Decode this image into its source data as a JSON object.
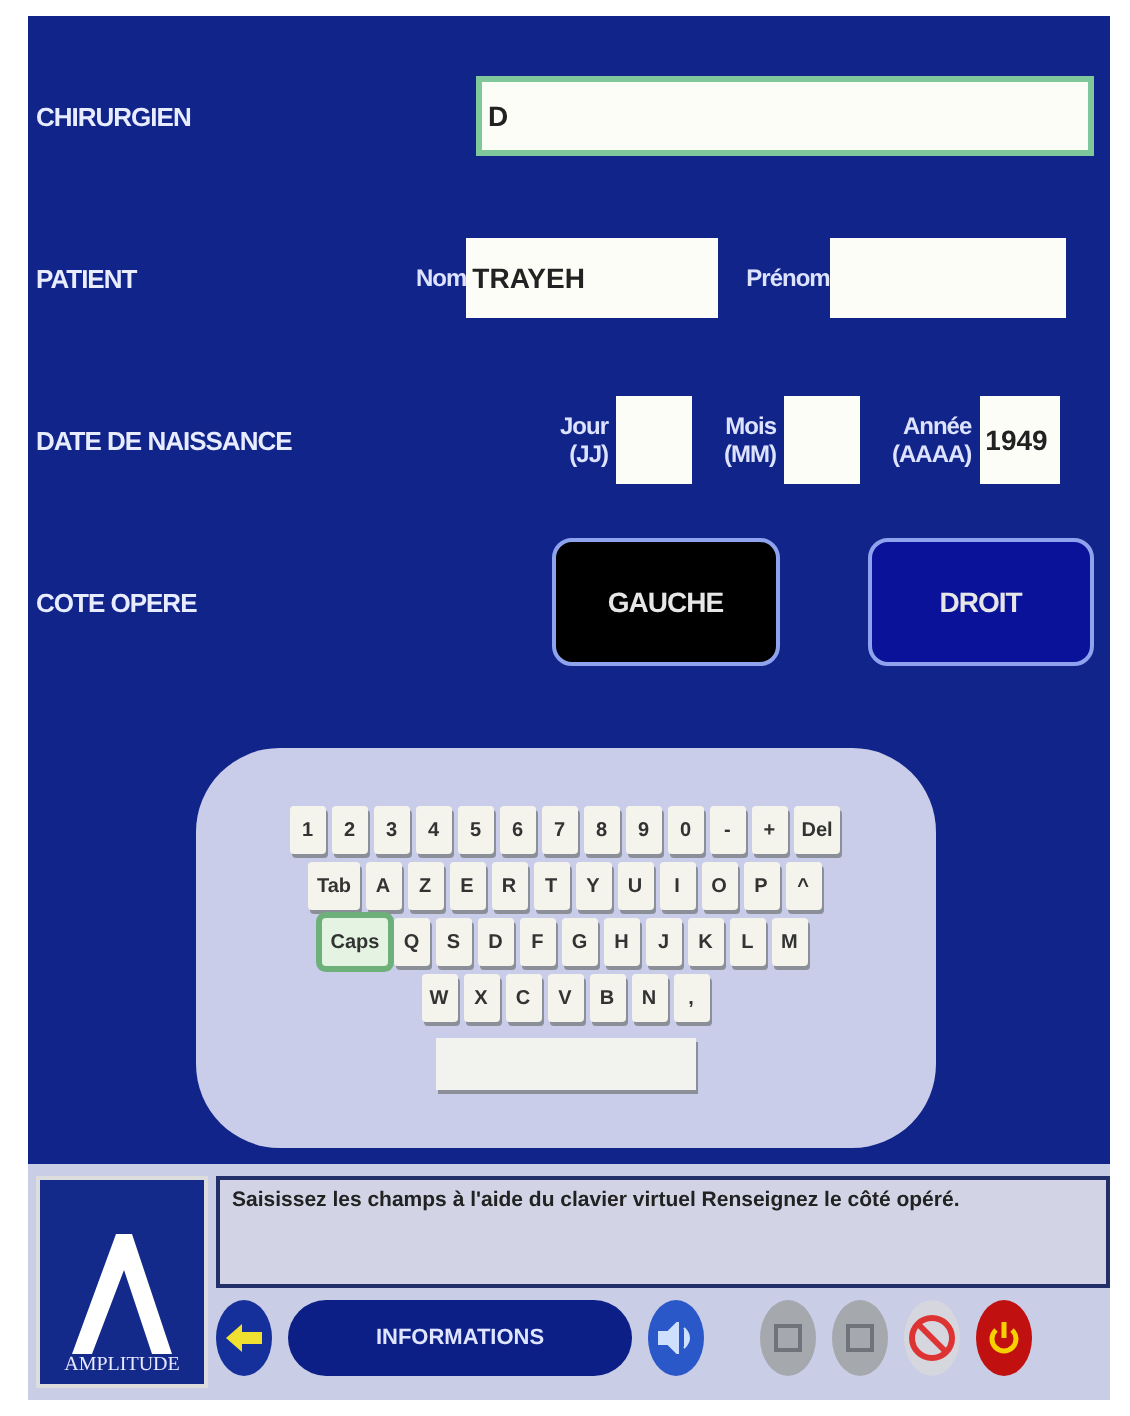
{
  "form": {
    "surgeon": {
      "label": "CHIRURGIEN",
      "value": "D"
    },
    "patient": {
      "label": "PATIENT",
      "last_name_label": "Nom",
      "last_name": "TRAYEH",
      "first_name_label": "Prénom"
    },
    "birth": {
      "label": "DATE DE NAISSANCE",
      "fields": [
        {
          "label": "Jour",
          "format": "(JJ)"
        },
        {
          "label": "Mois",
          "format": "(MM)"
        },
        {
          "label": "Année",
          "format": "(AAAA)",
          "value": "1949"
        }
      ]
    },
    "side": {
      "label": "COTE OPERE",
      "options": [
        {
          "label": "GAUCHE",
          "selected": true
        },
        {
          "label": "DROIT",
          "selected": false
        }
      ]
    }
  },
  "keyboard": {
    "rows": [
      {
        "keys": [
          {
            "label": "1"
          },
          {
            "label": "2"
          },
          {
            "label": "3"
          },
          {
            "label": "4"
          },
          {
            "label": "5"
          },
          {
            "label": "6"
          },
          {
            "label": "7"
          },
          {
            "label": "8"
          },
          {
            "label": "9"
          },
          {
            "label": "0"
          },
          {
            "label": "-"
          },
          {
            "label": "+"
          },
          {
            "label": "Del"
          }
        ]
      },
      {
        "keys": [
          {
            "label": "Tab"
          },
          {
            "label": "A"
          },
          {
            "label": "Z"
          },
          {
            "label": "E"
          },
          {
            "label": "R"
          },
          {
            "label": "T"
          },
          {
            "label": "Y"
          },
          {
            "label": "U"
          },
          {
            "label": "I"
          },
          {
            "label": "O"
          },
          {
            "label": "P"
          },
          {
            "label": "^"
          }
        ]
      },
      {
        "keys": [
          {
            "label": "Caps",
            "on": true
          },
          {
            "label": "Q"
          },
          {
            "label": "S"
          },
          {
            "label": "D"
          },
          {
            "label": "F"
          },
          {
            "label": "G"
          },
          {
            "label": "H"
          },
          {
            "label": "J"
          },
          {
            "label": "K"
          },
          {
            "label": "L"
          },
          {
            "label": "M"
          }
        ]
      },
      {
        "keys": [
          {
            "label": "W"
          },
          {
            "label": "X"
          },
          {
            "label": "C"
          },
          {
            "label": "V"
          },
          {
            "label": "B"
          },
          {
            "label": "N"
          },
          {
            "label": ","
          }
        ]
      }
    ]
  },
  "footer": {
    "logo_text": "AMPLITUDE",
    "message": "Saisissez les champs à l'aide du clavier virtuel Renseignez le côté opéré.",
    "info_button": "INFORMATIONS",
    "tools": [
      {
        "kind": "back"
      },
      {
        "kind": "sound"
      },
      {
        "kind": "grey"
      },
      {
        "kind": "grey"
      },
      {
        "kind": "cancel"
      },
      {
        "kind": "power"
      }
    ]
  }
}
